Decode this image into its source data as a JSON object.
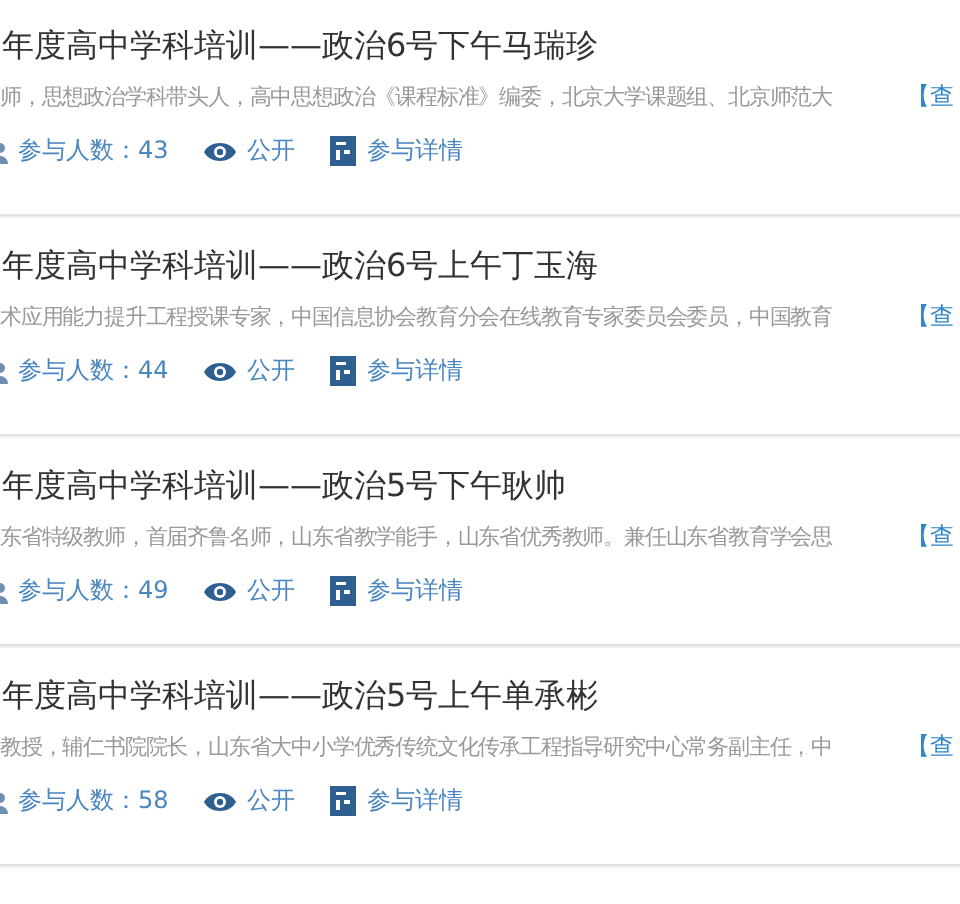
{
  "courses": [
    {
      "title": "年度高中学科培训——政治6号下午马瑞珍",
      "description": "师，思想政治学科带头人，高中思想政治《课程标准》编委，北京大学课题组、北京师范大",
      "more_link": "【查",
      "participants": "参与人数：43",
      "visibility": "公开",
      "details_link": "参与详情"
    },
    {
      "title": "年度高中学科培训——政治6号上午丁玉海",
      "description": "术应用能力提升工程授课专家，中国信息协会教育分会在线教育专家委员会委员，中国教育",
      "more_link": "【查",
      "participants": "参与人数：44",
      "visibility": "公开",
      "details_link": "参与详情"
    },
    {
      "title": "年度高中学科培训——政治5号下午耿帅",
      "description": "东省特级教师，首届齐鲁名师，山东省教学能手，山东省优秀教师。兼任山东省教育学会思",
      "more_link": "【查",
      "participants": "参与人数：49",
      "visibility": "公开",
      "details_link": "参与详情"
    },
    {
      "title": "年度高中学科培训——政治5号上午单承彬",
      "description": "教授，辅仁书院院长，山东省大中小学优秀传统文化传承工程指导研究中心常务副主任，中",
      "more_link": "【查",
      "participants": "参与人数：58",
      "visibility": "公开",
      "details_link": "参与详情"
    }
  ]
}
